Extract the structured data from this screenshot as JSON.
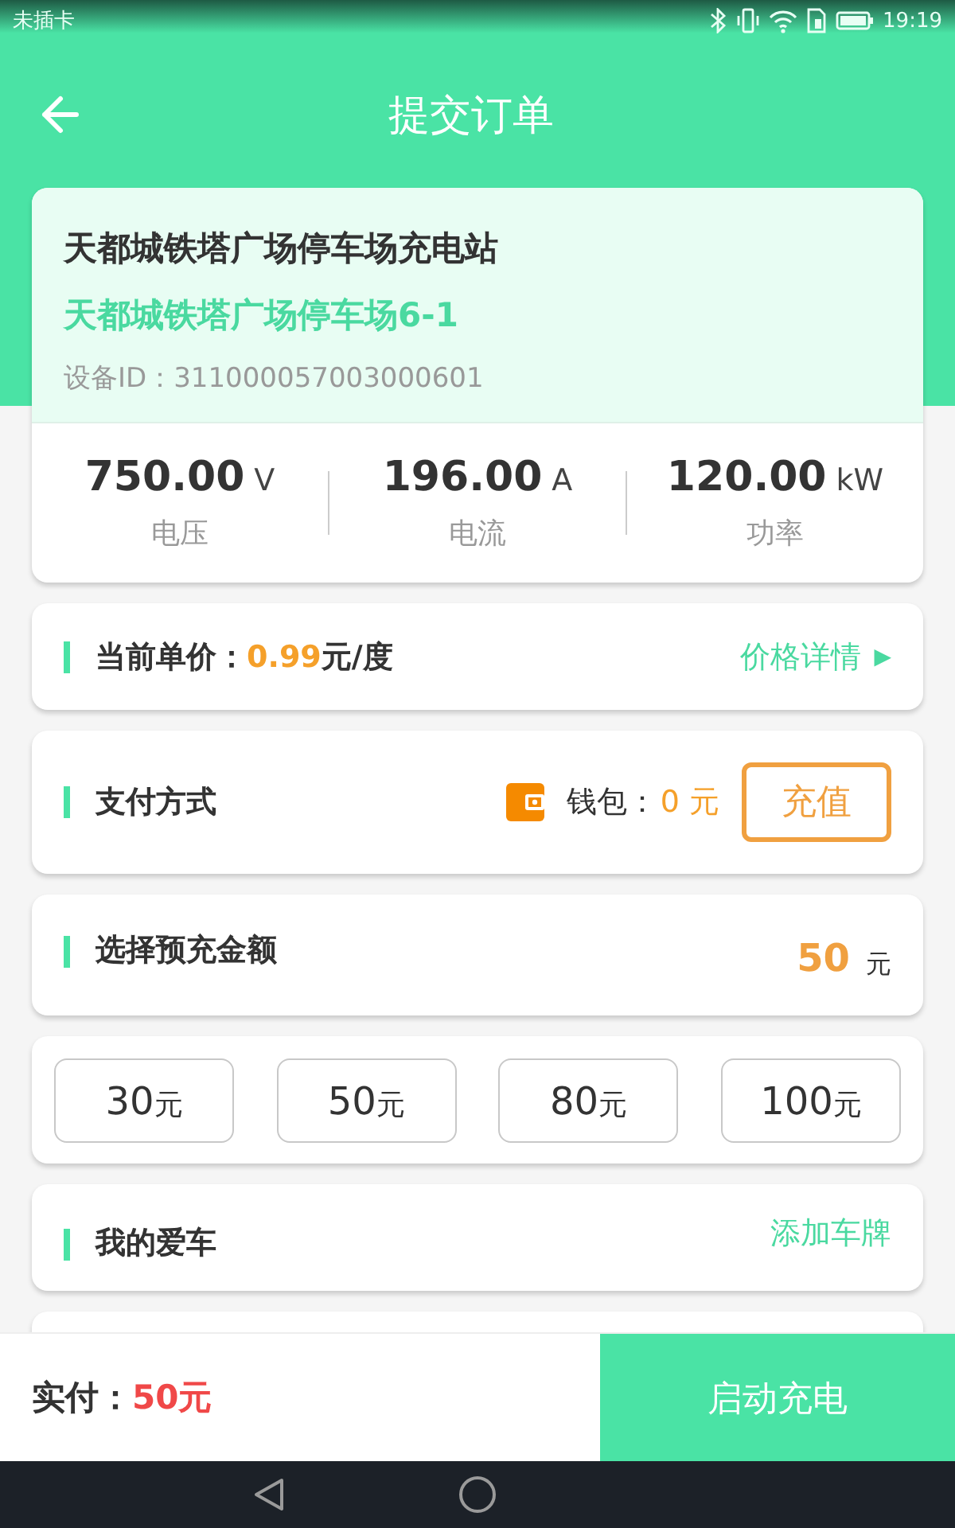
{
  "status_bar": {
    "carrier": "未插卡",
    "time": "19:19"
  },
  "header": {
    "title": "提交订单"
  },
  "station": {
    "name": "天都城铁塔广场停车场充电站",
    "pile": "天都城铁塔广场停车场6-1",
    "device_id": "设备ID：311000057003000601",
    "metrics": [
      {
        "value": "750.00",
        "unit": "V",
        "label": "电压"
      },
      {
        "value": "196.00",
        "unit": "A",
        "label": "电流"
      },
      {
        "value": "120.00",
        "unit": "kW",
        "label": "功率"
      }
    ]
  },
  "price": {
    "label": "当前单价：",
    "value": "0.99",
    "unit": "元/度",
    "link": "价格详情",
    "link_icon": "▶"
  },
  "payment": {
    "label": "支付方式",
    "wallet_label": "钱包：",
    "balance": "0 元",
    "recharge": "充值"
  },
  "amount": {
    "label": "选择预充金额",
    "value": "50",
    "unit": "元",
    "options": [
      {
        "value": "30",
        "unit": "元"
      },
      {
        "value": "50",
        "unit": "元"
      },
      {
        "value": "80",
        "unit": "元"
      },
      {
        "value": "100",
        "unit": "元"
      }
    ]
  },
  "car": {
    "label": "我的爱车",
    "link": "添加车牌"
  },
  "footer": {
    "label": "实付：",
    "amount": "50元",
    "button": "启动充电"
  }
}
